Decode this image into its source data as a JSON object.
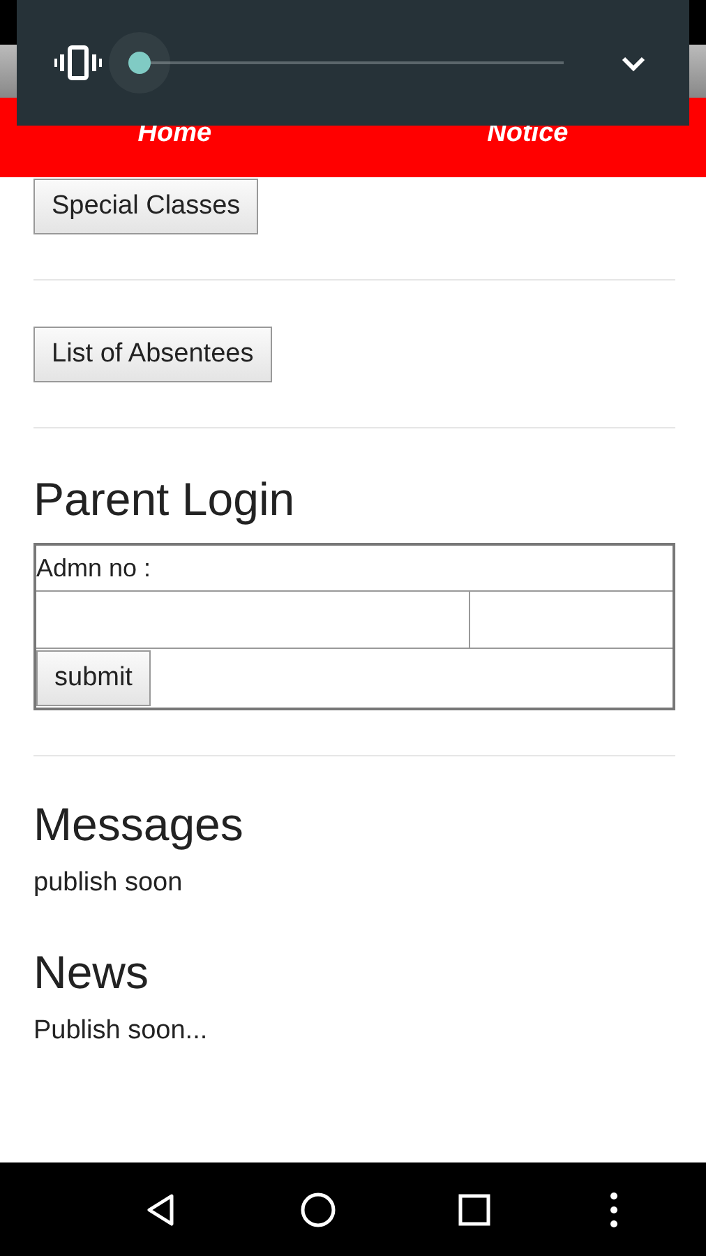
{
  "volume_panel": {
    "level": 0,
    "expanded": false
  },
  "nav": [
    {
      "label": "Home"
    },
    {
      "label": "Notice"
    }
  ],
  "buttons": [
    "Special Classes",
    "List of Absentees"
  ],
  "parent_login": {
    "title": "Parent Login",
    "label": "Admn no :",
    "submit": "submit"
  },
  "sections": [
    {
      "title": "Messages",
      "text": "publish soon"
    },
    {
      "title": "News",
      "text": "Publish soon..."
    }
  ]
}
